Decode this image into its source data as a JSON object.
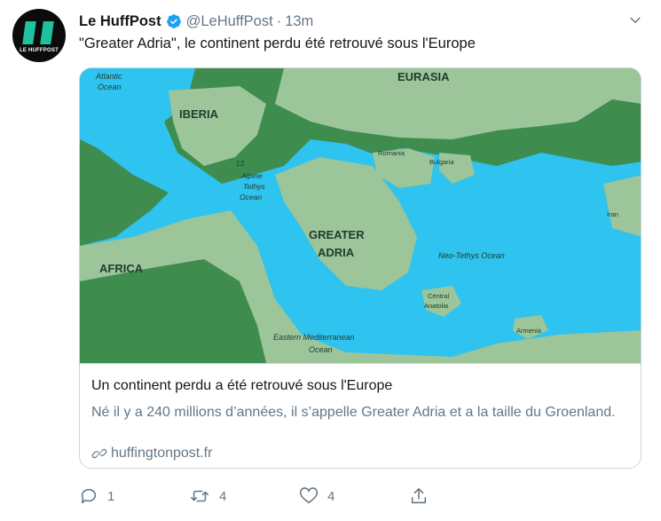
{
  "tweet": {
    "author_name": "Le HuffPost",
    "avatar_text": "LE HUFFPOST",
    "handle": "@LeHuffPost",
    "separator": "·",
    "time": "13m",
    "text": "\"Greater Adria\", le continent perdu été retrouvé sous l'Europe"
  },
  "card": {
    "title": "Un continent perdu a été retrouvé sous l'Europe",
    "description": "Né il y a 240 millions d’années, il s’appelle Greater Adria et a la taille du Groenland.",
    "domain": "huffingtonpost.fr",
    "map_labels": {
      "atlantic_1": "Atlantic",
      "atlantic_2": "Ocean",
      "iberia": "IBERIA",
      "eurasia": "EURASIA",
      "alpine_1": "Alpine",
      "alpine_2": "Tethys",
      "alpine_3": "Ocean",
      "romania": "Romania",
      "bulgaria": "Bulgaria",
      "greater_1": "GREATER",
      "greater_2": "ADRIA",
      "neo_tethys": "Neo-Tethys Ocean",
      "iran": "Iran",
      "africa": "AFRICA",
      "central_1": "Central",
      "central_2": "Anatolia",
      "armenia": "Armenia",
      "east_med_1": "Eastern Mediterranean",
      "east_med_2": "Ocean",
      "number": "13"
    }
  },
  "actions": {
    "replies": "1",
    "retweets": "4",
    "likes": "4"
  },
  "colors": {
    "land_dark": "#3e8c4e",
    "land_light": "#9cc59a",
    "ocean": "#2fc3ef",
    "accent": "#1da1f2"
  }
}
